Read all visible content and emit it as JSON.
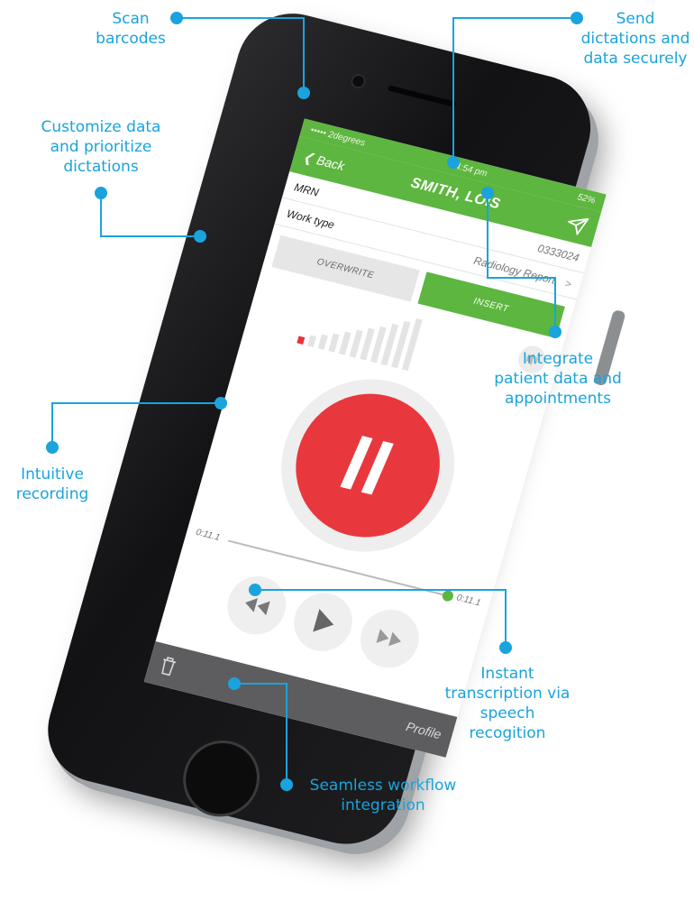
{
  "callouts": {
    "scan": "Scan\nbarcodes",
    "send": "Send\ndictations and\ndata securely",
    "customize": "Customize data\nand prioritize\ndictations",
    "integrate": "Integrate\npatient data and\nappointments",
    "intuitive": "Intuitive\nrecording",
    "instant": "Instant\ntranscription via\nspeech\nrecogition",
    "seamless": "Seamless workflow\nintegration"
  },
  "phone": {
    "status": {
      "carrier": "••••• 2degrees",
      "time": "4:54 pm",
      "battery": "52%"
    },
    "nav": {
      "back": "Back",
      "title": "SMITH, LOIS"
    },
    "mrn": {
      "label": "MRN",
      "value": "0333024"
    },
    "work_type": {
      "label": "Work type",
      "value": "Radiology Report"
    },
    "toggle": {
      "overwrite": "OVERWRITE",
      "insert": "INSERT"
    },
    "timeline": {
      "start": "0:11.1",
      "end": "0:11.1"
    },
    "bottom": {
      "profile": "Profile"
    }
  },
  "colors": {
    "accent": "#1aa3dc",
    "green": "#5db63f",
    "record": "#e8383e"
  }
}
